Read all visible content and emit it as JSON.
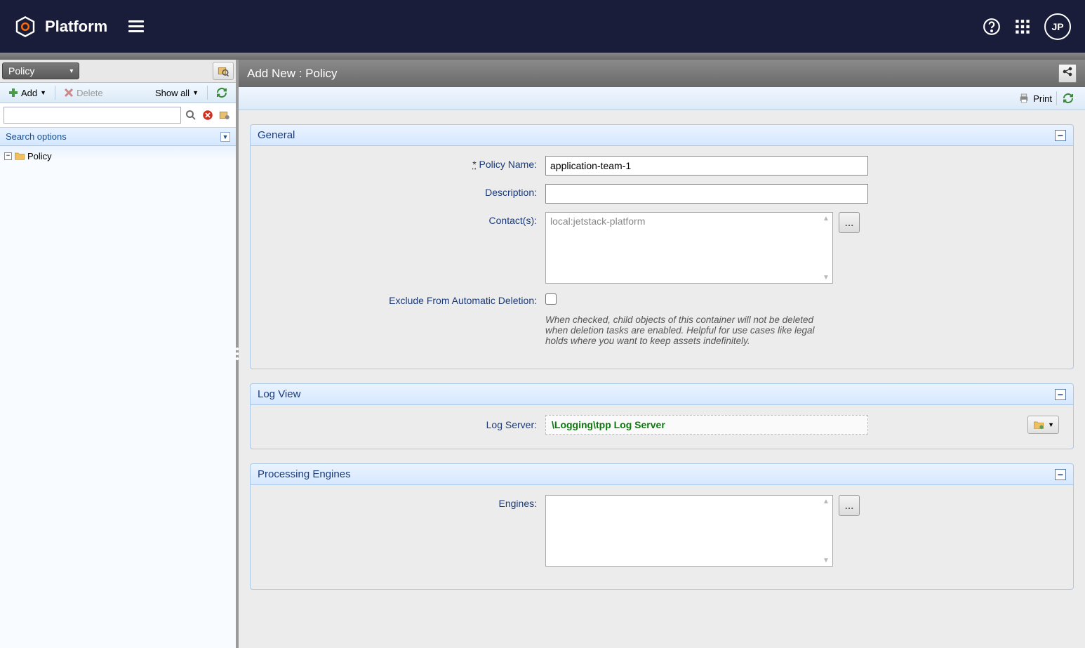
{
  "header": {
    "brand": "Platform",
    "avatar_initials": "JP"
  },
  "sidebar": {
    "dropdown_label": "Policy",
    "toolbar": {
      "add_label": "Add",
      "delete_label": "Delete",
      "showall_label": "Show all"
    },
    "search_options_label": "Search options",
    "tree": {
      "root_label": "Policy"
    }
  },
  "content": {
    "title": "Add New : Policy",
    "print_label": "Print"
  },
  "panels": {
    "general": {
      "title": "General",
      "fields": {
        "policy_name_label": "Policy Name:",
        "policy_name_value": "application-team-1",
        "description_label": "Description:",
        "description_value": "",
        "contacts_label": "Contact(s):",
        "contacts_placeholder": "local:jetstack-platform",
        "exclude_label": "Exclude From Automatic Deletion:",
        "exclude_help": "When checked, child objects of this container will not be deleted when deletion tasks are enabled. Helpful for use cases like legal holds where you want to keep assets indefinitely."
      }
    },
    "logview": {
      "title": "Log View",
      "fields": {
        "logserver_label": "Log Server:",
        "logserver_value": "\\Logging\\tpp Log Server"
      }
    },
    "engines": {
      "title": "Processing Engines",
      "fields": {
        "engines_label": "Engines:"
      }
    }
  }
}
